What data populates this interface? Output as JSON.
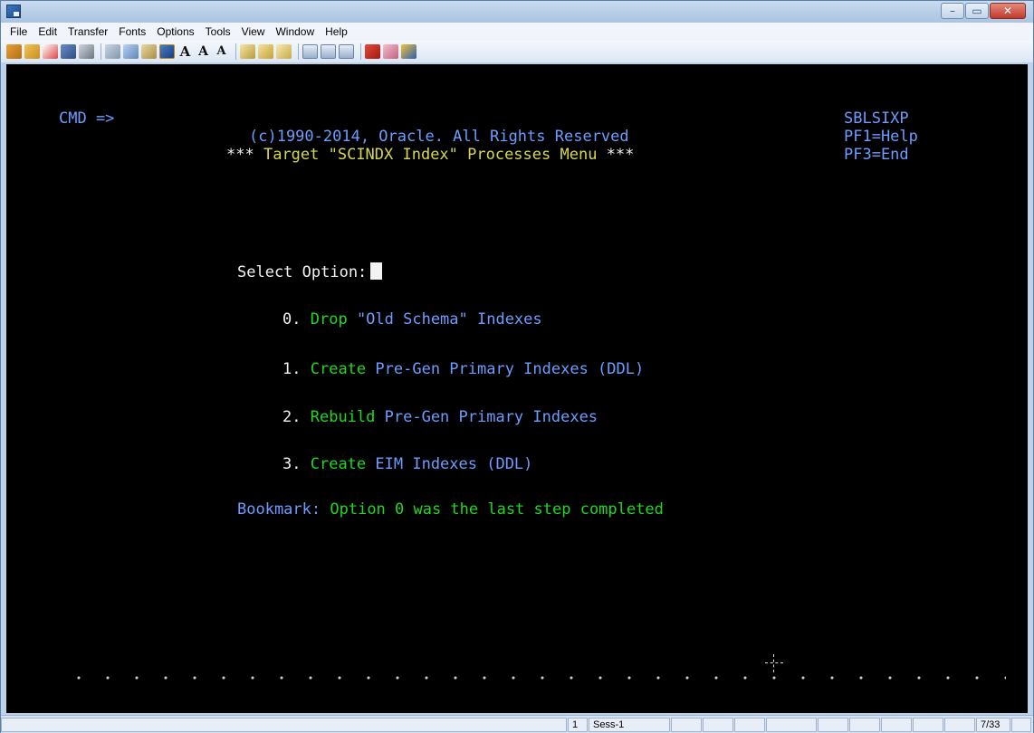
{
  "window": {
    "controls": {
      "minimize": "–",
      "maximize": "▭",
      "close": "✕"
    }
  },
  "menu": [
    "File",
    "Edit",
    "Transfer",
    "Fonts",
    "Options",
    "Tools",
    "View",
    "Window",
    "Help"
  ],
  "toolbar": {
    "font_large": "A",
    "font_medium": "A",
    "font_small": "A"
  },
  "terminal": {
    "cmd_prompt": "CMD =>",
    "program_id": "SBLSIXP",
    "pf1": "PF1=Help",
    "pf3": "PF3=End",
    "copyright": "(c)1990-2014, Oracle. All Rights Reserved",
    "title_stars_left": "***",
    "title_text": "Target \"SCINDX Index\" Processes Menu",
    "title_stars_right": "***",
    "select_label": "Select Option:",
    "options": [
      {
        "num": "0.",
        "verb": "Drop",
        "rest": "\"Old Schema\" Indexes"
      },
      {
        "num": "1.",
        "verb": "Create",
        "rest": "Pre-Gen Primary Indexes (DDL)"
      },
      {
        "num": "2.",
        "verb": "Rebuild",
        "rest": "Pre-Gen Primary Indexes"
      },
      {
        "num": "3.",
        "verb": "Create",
        "rest": "EIM Indexes (DDL)"
      }
    ],
    "bookmark_label": "Bookmark:",
    "bookmark_text": "Option 0 was the last step completed"
  },
  "statusbar": {
    "session_num": "1",
    "session_name": "Sess-1",
    "cursor_pos": "7/33"
  },
  "colors": {
    "screen_bg": "#000000",
    "text_white": "#f2f2f2",
    "text_blue": "#6c9dff",
    "text_yellow": "#d8d850",
    "text_green": "#1fd81f"
  }
}
